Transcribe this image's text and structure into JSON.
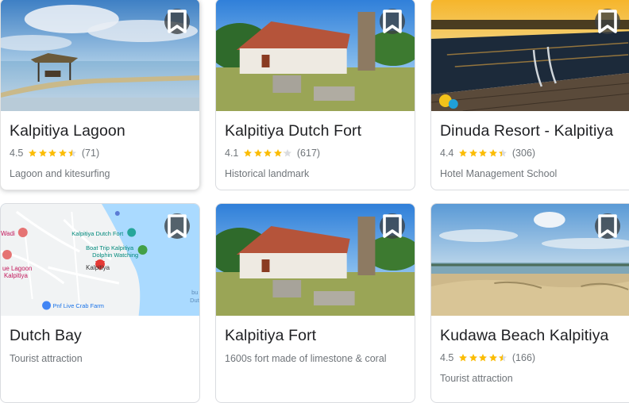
{
  "colors": {
    "star": "#fbbc04",
    "star_empty": "#dadce0",
    "title": "#202124",
    "meta": "#70757a"
  },
  "cards": [
    {
      "title": "Kalpitiya Lagoon",
      "rating": "4.5",
      "rating_value": 4.5,
      "reviews": "(71)",
      "description": "Lagoon and kitesurfing",
      "bookmark_icon": "bookmark-icon"
    },
    {
      "title": "Kalpitiya Dutch Fort",
      "rating": "4.1",
      "rating_value": 4.1,
      "reviews": "(617)",
      "description": "Historical landmark",
      "bookmark_icon": "bookmark-icon"
    },
    {
      "title": "Dinuda Resort - Kalpitiya",
      "rating": "4.4",
      "rating_value": 4.4,
      "reviews": "(306)",
      "description": "Hotel Management School",
      "bookmark_icon": "bookmark-icon"
    },
    {
      "title": "Dutch Bay",
      "description": "Tourist attraction",
      "bookmark_icon": "bookmark-icon",
      "map_labels": {
        "place_1": "Wadi",
        "place_2": "ue Lagoon",
        "place_3": "Kalpitiya",
        "fort": "Kalpitiya Dutch Fort",
        "boat_1": "Boat Trip Kalpitiya",
        "boat_2": "Dolphin Watching",
        "town": "Kalpitiya",
        "farm": "Pnf Live Crab Farm",
        "bay": "Dutch",
        "bay_2": "bu"
      }
    },
    {
      "title": "Kalpitiya Fort",
      "description": "1600s fort made of limestone & coral",
      "bookmark_icon": "bookmark-icon"
    },
    {
      "title": "Kudawa Beach Kalpitiya",
      "rating": "4.5",
      "rating_value": 4.5,
      "reviews": "(166)",
      "description": "Tourist attraction",
      "bookmark_icon": "bookmark-icon"
    }
  ]
}
